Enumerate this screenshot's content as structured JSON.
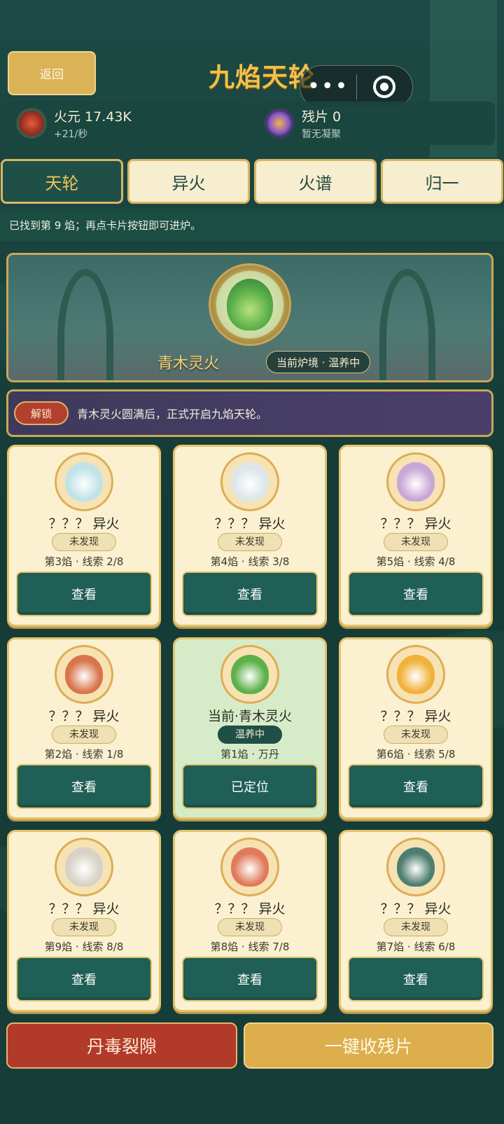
{
  "header": {
    "back_label": "返回",
    "title": "九焰天轮",
    "more_glyph": "•••"
  },
  "stats": {
    "fire": {
      "label": "火元 17.43K",
      "rate": "+21/秒"
    },
    "fragment": {
      "label": "残片 0",
      "sub": "暂无凝聚"
    }
  },
  "tabs": [
    {
      "label": "天轮",
      "active": true
    },
    {
      "label": "异火",
      "active": false
    },
    {
      "label": "火谱",
      "active": false
    },
    {
      "label": "归一",
      "active": false
    }
  ],
  "notice": "已找到第 9 焰；再点卡片按钮即可进炉。",
  "banner": {
    "fire_name": "青木灵火",
    "state": "当前炉境 · 温养中"
  },
  "unlock": {
    "tag": "解锁",
    "message": "青木灵火圆满后，正式开启九焰天轮。"
  },
  "cards": [
    {
      "name": "？？？ 异火",
      "status": "未发现",
      "hint": "第3焰 · 线索 2/8",
      "button": "查看",
      "color": "#bfe3e6"
    },
    {
      "name": "？？？ 异火",
      "status": "未发现",
      "hint": "第4焰 · 线索 3/8",
      "button": "查看",
      "color": "#dde6ea"
    },
    {
      "name": "？？？ 异火",
      "status": "未发现",
      "hint": "第5焰 · 线索 4/8",
      "button": "查看",
      "color": "#c9a6d8"
    },
    {
      "name": "？？？ 异火",
      "status": "未发现",
      "hint": "第2焰 · 线索 1/8",
      "button": "查看",
      "color": "#d9754a"
    },
    {
      "name": "当前·青木灵火",
      "status": "温养中",
      "hint": "第1焰 · 万丹",
      "button": "已定位",
      "color": "#5bb04a",
      "current": true
    },
    {
      "name": "？？？ 异火",
      "status": "未发现",
      "hint": "第6焰 · 线索 5/8",
      "button": "查看",
      "color": "#f0b23a"
    },
    {
      "name": "？？？ 异火",
      "status": "未发现",
      "hint": "第9焰 · 线索 8/8",
      "button": "查看",
      "color": "#d8d2c6"
    },
    {
      "name": "？？？ 异火",
      "status": "未发现",
      "hint": "第8焰 · 线索 7/8",
      "button": "查看",
      "color": "#e07a5a"
    },
    {
      "name": "？？？ 异火",
      "status": "未发现",
      "hint": "第7焰 · 线索 6/8",
      "button": "查看",
      "color": "#4e7e70"
    }
  ],
  "bottom": {
    "left_label": "丹毒裂隙",
    "right_label": "一键收残片"
  }
}
